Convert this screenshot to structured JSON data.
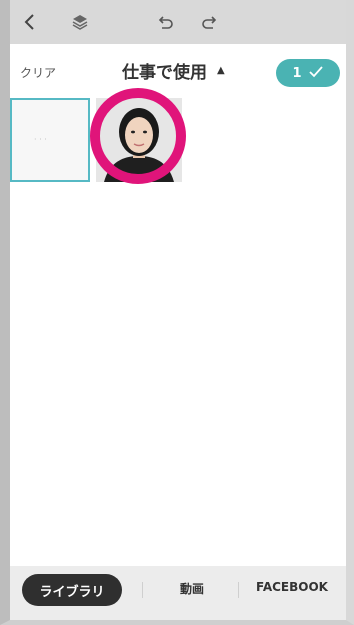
{
  "toolbar": {
    "icons": [
      "back-icon",
      "layers-icon",
      "undo-icon",
      "redo-icon"
    ]
  },
  "header": {
    "clear_label": "クリア",
    "title": "仕事で使用",
    "title_caret": "▲",
    "selected_count": "1",
    "confirm_icon": "check-icon"
  },
  "grid": {
    "items": [
      {
        "type": "selected-placeholder"
      },
      {
        "type": "photo"
      }
    ]
  },
  "tabs": {
    "items": [
      {
        "label": "ライブラリ",
        "active": true
      },
      {
        "label": "動画",
        "active": false
      },
      {
        "label": "FACEBOOK",
        "active": false
      }
    ]
  },
  "colors": {
    "accent": "#4ab3b3",
    "highlight_ring": "#e0147a",
    "selection_border": "#56b9c4",
    "tab_active_bg": "#2f2f2f"
  }
}
